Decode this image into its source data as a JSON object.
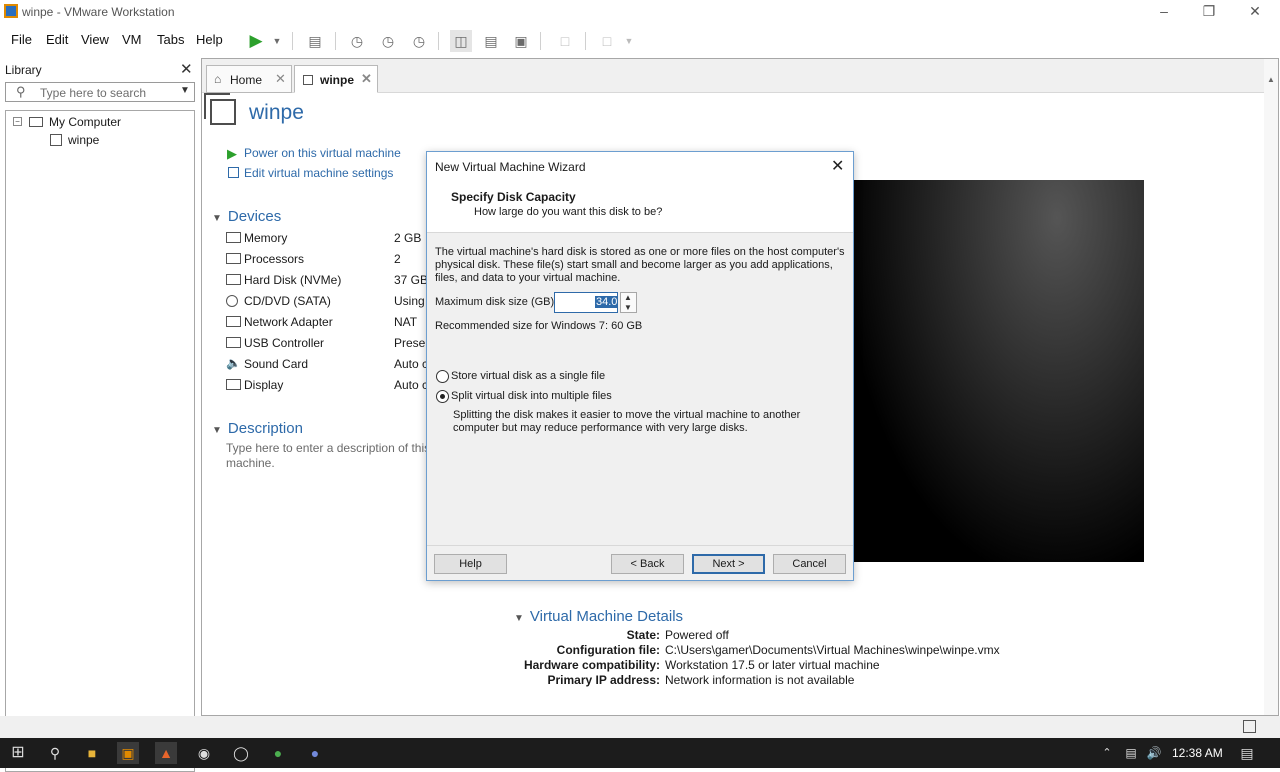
{
  "window": {
    "title": "winpe - VMware Workstation"
  },
  "menu": {
    "file": "File",
    "edit": "Edit",
    "view": "View",
    "vm": "VM",
    "tabs": "Tabs",
    "help": "Help"
  },
  "library": {
    "title": "Library",
    "search_placeholder": "Type here to search",
    "tree": [
      "My Computer",
      "winpe"
    ]
  },
  "tabs": [
    {
      "label": "Home"
    },
    {
      "label": "winpe"
    }
  ],
  "vm": {
    "name": "winpe",
    "actions": [
      "Power on this virtual machine",
      "Edit virtual machine settings"
    ],
    "devices_heading": "Devices",
    "devices": [
      {
        "name": "Memory",
        "value": "2 GB",
        "icon": "memory-icon"
      },
      {
        "name": "Processors",
        "value": "2",
        "icon": "processor-icon"
      },
      {
        "name": "Hard Disk (NVMe)",
        "value": "37 GB",
        "icon": "hard-disk-icon"
      },
      {
        "name": "CD/DVD (SATA)",
        "value": "Using",
        "icon": "cd-dvd-icon"
      },
      {
        "name": "Network Adapter",
        "value": "NAT",
        "icon": "network-adapter-icon"
      },
      {
        "name": "USB Controller",
        "value": "Preser",
        "icon": "usb-icon"
      },
      {
        "name": "Sound Card",
        "value": "Auto c",
        "icon": "sound-icon"
      },
      {
        "name": "Display",
        "value": "Auto c",
        "icon": "display-icon"
      }
    ],
    "description_heading": "Description",
    "description_placeholder": "Type here to enter a description of this machine.",
    "details_heading": "Virtual Machine Details",
    "details": [
      {
        "label": "State:",
        "value": "Powered off"
      },
      {
        "label": "Configuration file:",
        "value": "C:\\Users\\gamer\\Documents\\Virtual Machines\\winpe\\winpe.vmx"
      },
      {
        "label": "Hardware compatibility:",
        "value": "Workstation 17.5 or later virtual machine"
      },
      {
        "label": "Primary IP address:",
        "value": "Network information is not available"
      }
    ]
  },
  "dialog": {
    "title": "New Virtual Machine Wizard",
    "heading": "Specify Disk Capacity",
    "subheading": "How large do you want this disk to be?",
    "intro": "The virtual machine's hard disk is stored as one or more files on the host computer's physical disk. These file(s) start small and become larger as you add applications, files, and data to your virtual machine.",
    "max_size_label": "Maximum disk size (GB):",
    "max_size_value": "34.0",
    "recommended": "Recommended size for Windows 7: 60 GB",
    "option_single": "Store virtual disk as a single file",
    "option_split": "Split virtual disk into multiple files",
    "option_split_desc": "Splitting the disk makes it easier to move the virtual machine to another computer but may reduce performance with very large disks.",
    "selected_option": "split",
    "buttons": {
      "help": "Help",
      "back": "< Back",
      "next": "Next >",
      "cancel": "Cancel"
    }
  },
  "taskbar": {
    "time": "12:38 AM"
  }
}
